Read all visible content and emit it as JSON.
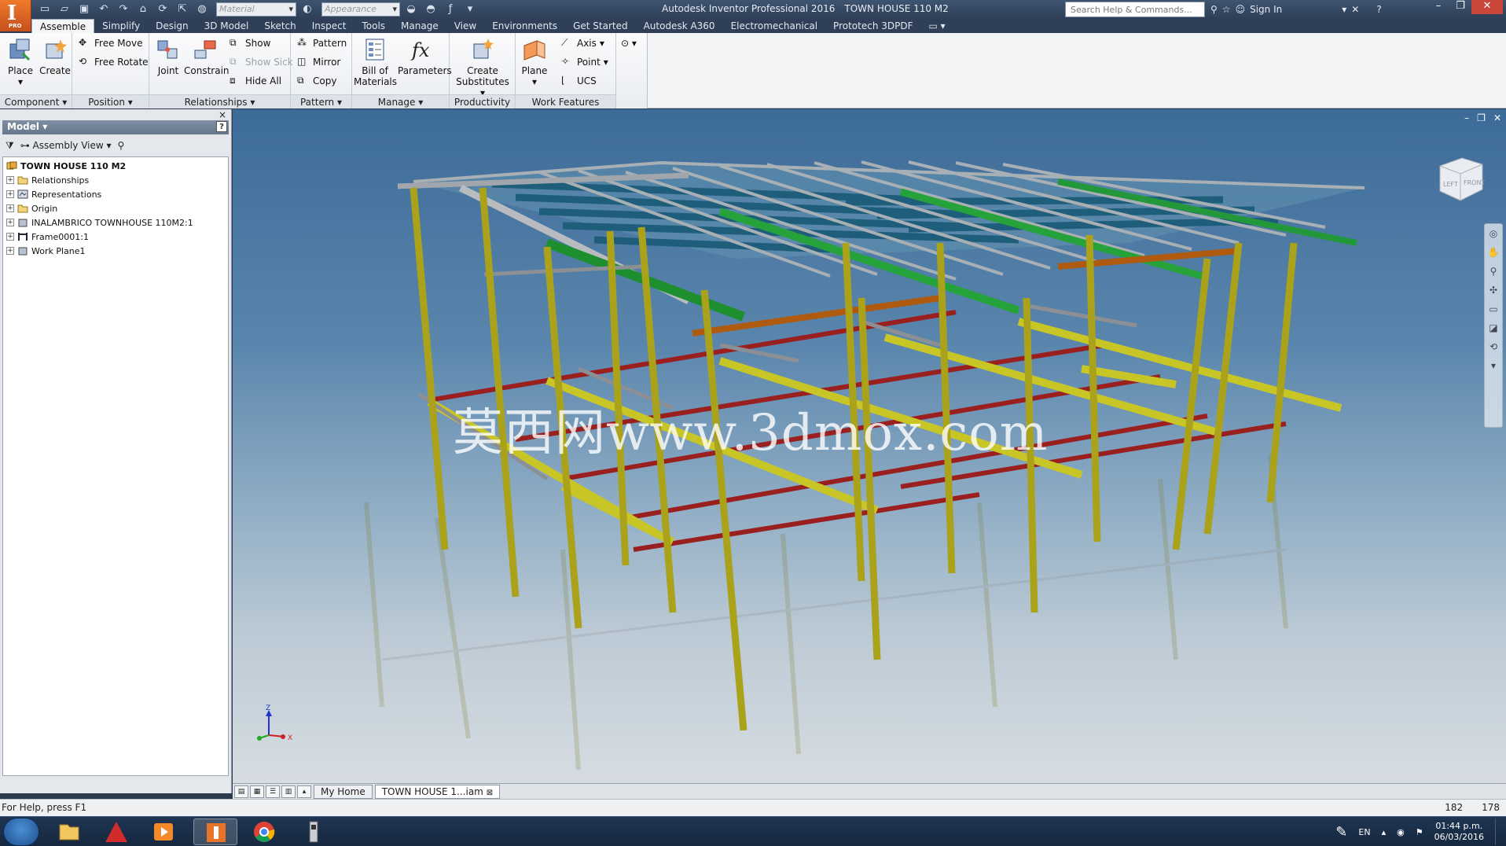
{
  "app": {
    "logo_letter": "I",
    "logo_sub": "PRO",
    "product": "Autodesk Inventor Professional 2016",
    "document": "TOWN HOUSE 110 M2"
  },
  "qat": {
    "material_placeholder": "Material",
    "appearance_placeholder": "Appearance"
  },
  "search": {
    "placeholder": "Search Help & Commands..."
  },
  "account": {
    "sign_in": "Sign In"
  },
  "tabs": [
    {
      "label": "Assemble"
    },
    {
      "label": "Simplify"
    },
    {
      "label": "Design"
    },
    {
      "label": "3D Model"
    },
    {
      "label": "Sketch"
    },
    {
      "label": "Inspect"
    },
    {
      "label": "Tools"
    },
    {
      "label": "Manage"
    },
    {
      "label": "View"
    },
    {
      "label": "Environments"
    },
    {
      "label": "Get Started"
    },
    {
      "label": "Autodesk A360"
    },
    {
      "label": "Electromechanical"
    },
    {
      "label": "Prototech 3DPDF"
    }
  ],
  "ribbon": {
    "component": {
      "label": "Component",
      "place": "Place",
      "create": "Create"
    },
    "position": {
      "label": "Position",
      "free_move": "Free Move",
      "free_rotate": "Free Rotate"
    },
    "relationships": {
      "label": "Relationships",
      "joint": "Joint",
      "constrain": "Constrain",
      "show": "Show",
      "show_sick": "Show Sick",
      "hide_all": "Hide All"
    },
    "pattern": {
      "label": "Pattern",
      "pattern": "Pattern",
      "mirror": "Mirror",
      "copy": "Copy"
    },
    "manage": {
      "label": "Manage",
      "bom_1": "Bill of",
      "bom_2": "Materials",
      "parameters": "Parameters"
    },
    "productivity": {
      "label": "Productivity",
      "create_sub_1": "Create",
      "create_sub_2": "Substitutes"
    },
    "work_features": {
      "label": "Work Features",
      "plane": "Plane",
      "axis": "Axis",
      "point": "Point",
      "ucs": "UCS"
    }
  },
  "model_browser": {
    "title": "Model",
    "help": "?",
    "view": "Assembly View",
    "root": "TOWN HOUSE 110 M2",
    "items": [
      {
        "label": "Relationships"
      },
      {
        "label": "Representations"
      },
      {
        "label": "Origin"
      },
      {
        "label": "INALAMBRICO TOWNHOUSE 110M2:1"
      },
      {
        "label": "Frame0001:1"
      },
      {
        "label": "Work Plane1"
      }
    ]
  },
  "viewport": {
    "watermark": "莫西网www.3dmox.com",
    "cube_left": "LEFT",
    "cube_front": "FRONT",
    "axis_z": "Z",
    "axis_x": "X"
  },
  "doc_tabs": [
    {
      "label": "My Home"
    },
    {
      "label": "TOWN HOUSE 1...iam"
    }
  ],
  "status": {
    "help": "For Help, press F1",
    "n1": "182",
    "n2": "178"
  },
  "tray": {
    "lang": "EN",
    "time": "01:44 p.m.",
    "date": "06/03/2016"
  }
}
